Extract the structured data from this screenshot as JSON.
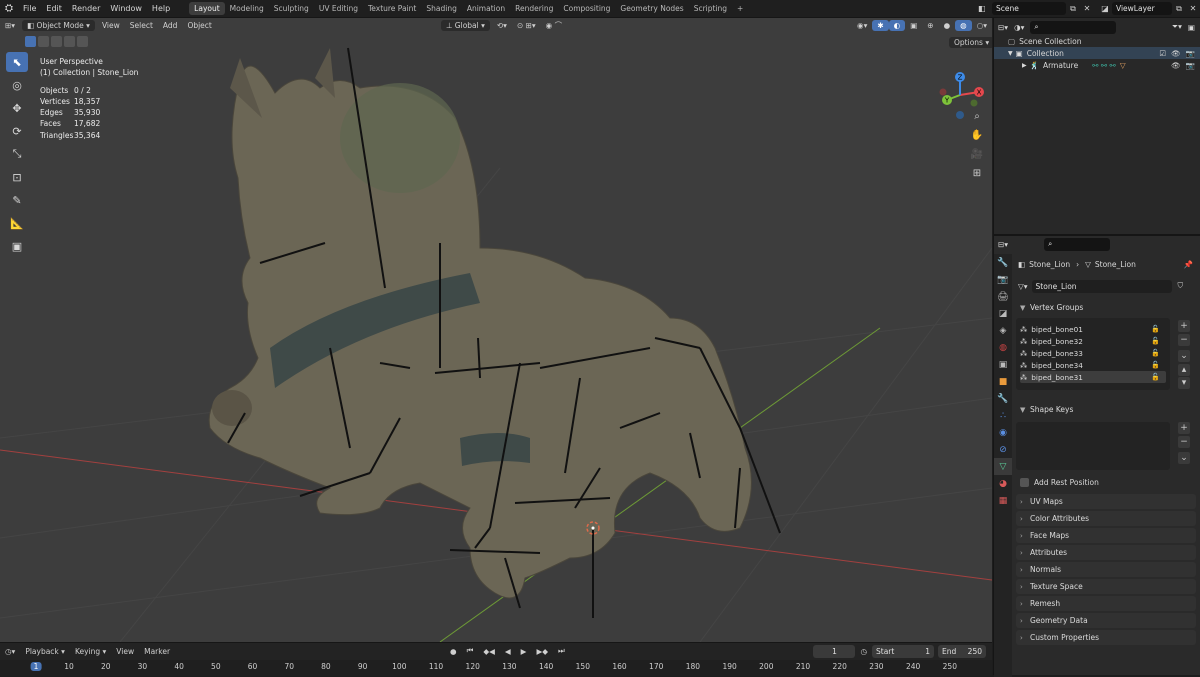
{
  "menu": {
    "items": [
      "File",
      "Edit",
      "Render",
      "Window",
      "Help"
    ],
    "workspaces": [
      "Layout",
      "Modeling",
      "Sculpting",
      "UV Editing",
      "Texture Paint",
      "Shading",
      "Animation",
      "Rendering",
      "Compositing",
      "Geometry Nodes",
      "Scripting"
    ],
    "active_workspace": "Layout",
    "add_tab": "+",
    "scene": "Scene",
    "view_layer": "ViewLayer"
  },
  "viewport": {
    "mode": "Object Mode",
    "menus": [
      "View",
      "Select",
      "Add",
      "Object"
    ],
    "orientation": "Global",
    "options": "Options",
    "perspective": "User Perspective",
    "collection_path": "(1) Collection | Stone_Lion",
    "stats": [
      {
        "label": "Objects",
        "value": "0 / 2"
      },
      {
        "label": "Vertices",
        "value": "18,357"
      },
      {
        "label": "Edges",
        "value": "35,930"
      },
      {
        "label": "Faces",
        "value": "17,682"
      },
      {
        "label": "Triangles",
        "value": "35,364"
      }
    ],
    "gizmo": {
      "x": "X",
      "y": "Y",
      "z": "Z"
    }
  },
  "timeline": {
    "menus": [
      "Playback",
      "Keying",
      "View",
      "Marker"
    ],
    "current_frame": "1",
    "start_label": "Start",
    "start": "1",
    "end_label": "End",
    "end": "250",
    "ruler": [
      "1",
      "10",
      "20",
      "30",
      "40",
      "50",
      "60",
      "70",
      "80",
      "90",
      "100",
      "110",
      "120",
      "130",
      "140",
      "150",
      "160",
      "170",
      "180",
      "190",
      "200",
      "210",
      "220",
      "230",
      "240",
      "250"
    ]
  },
  "outliner": {
    "root": "Scene Collection",
    "collection": "Collection",
    "child": "Armature"
  },
  "properties": {
    "breadcrumb_object": "Stone_Lion",
    "breadcrumb_data": "Stone_Lion",
    "mesh_name": "Stone_Lion",
    "vertex_groups_title": "Vertex Groups",
    "vertex_groups": [
      "biped_bone01",
      "biped_bone32",
      "biped_bone33",
      "biped_bone34",
      "biped_bone31"
    ],
    "shape_keys_title": "Shape Keys",
    "add_rest_position": "Add Rest Position",
    "panels": [
      "UV Maps",
      "Color Attributes",
      "Face Maps",
      "Attributes",
      "Normals",
      "Texture Space",
      "Remesh",
      "Geometry Data",
      "Custom Properties"
    ]
  },
  "colors": {
    "accent": "#4772b3",
    "viewport_bg": "#3d3d3d",
    "axis_x": "#e5484d",
    "axis_y": "#7ec33a",
    "axis_z": "#3d8be8",
    "frame_indicator": "#4772b3"
  }
}
